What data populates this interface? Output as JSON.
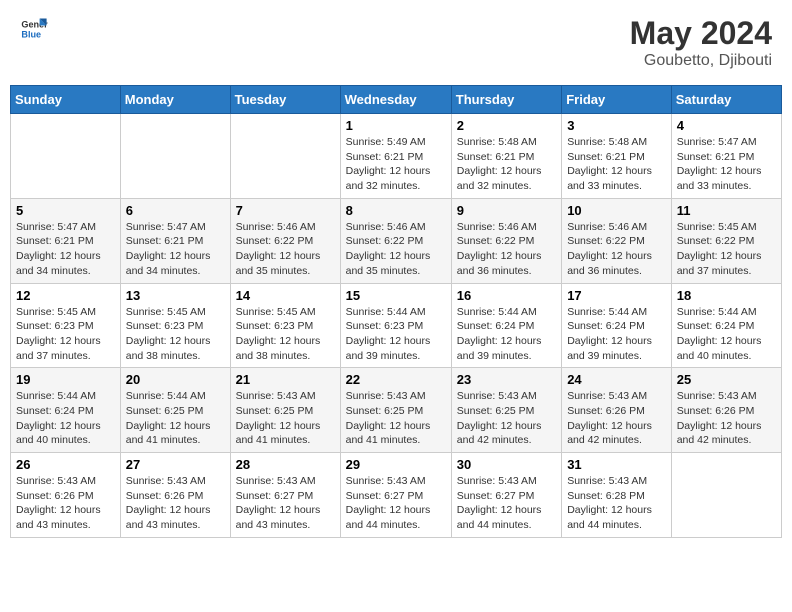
{
  "header": {
    "logo_general": "General",
    "logo_blue": "Blue",
    "month": "May 2024",
    "location": "Goubetto, Djibouti"
  },
  "days_of_week": [
    "Sunday",
    "Monday",
    "Tuesday",
    "Wednesday",
    "Thursday",
    "Friday",
    "Saturday"
  ],
  "weeks": [
    [
      {
        "day": "",
        "sunrise": "",
        "sunset": "",
        "daylight": ""
      },
      {
        "day": "",
        "sunrise": "",
        "sunset": "",
        "daylight": ""
      },
      {
        "day": "",
        "sunrise": "",
        "sunset": "",
        "daylight": ""
      },
      {
        "day": "1",
        "sunrise": "Sunrise: 5:49 AM",
        "sunset": "Sunset: 6:21 PM",
        "daylight": "Daylight: 12 hours and 32 minutes."
      },
      {
        "day": "2",
        "sunrise": "Sunrise: 5:48 AM",
        "sunset": "Sunset: 6:21 PM",
        "daylight": "Daylight: 12 hours and 32 minutes."
      },
      {
        "day": "3",
        "sunrise": "Sunrise: 5:48 AM",
        "sunset": "Sunset: 6:21 PM",
        "daylight": "Daylight: 12 hours and 33 minutes."
      },
      {
        "day": "4",
        "sunrise": "Sunrise: 5:47 AM",
        "sunset": "Sunset: 6:21 PM",
        "daylight": "Daylight: 12 hours and 33 minutes."
      }
    ],
    [
      {
        "day": "5",
        "sunrise": "Sunrise: 5:47 AM",
        "sunset": "Sunset: 6:21 PM",
        "daylight": "Daylight: 12 hours and 34 minutes."
      },
      {
        "day": "6",
        "sunrise": "Sunrise: 5:47 AM",
        "sunset": "Sunset: 6:21 PM",
        "daylight": "Daylight: 12 hours and 34 minutes."
      },
      {
        "day": "7",
        "sunrise": "Sunrise: 5:46 AM",
        "sunset": "Sunset: 6:22 PM",
        "daylight": "Daylight: 12 hours and 35 minutes."
      },
      {
        "day": "8",
        "sunrise": "Sunrise: 5:46 AM",
        "sunset": "Sunset: 6:22 PM",
        "daylight": "Daylight: 12 hours and 35 minutes."
      },
      {
        "day": "9",
        "sunrise": "Sunrise: 5:46 AM",
        "sunset": "Sunset: 6:22 PM",
        "daylight": "Daylight: 12 hours and 36 minutes."
      },
      {
        "day": "10",
        "sunrise": "Sunrise: 5:46 AM",
        "sunset": "Sunset: 6:22 PM",
        "daylight": "Daylight: 12 hours and 36 minutes."
      },
      {
        "day": "11",
        "sunrise": "Sunrise: 5:45 AM",
        "sunset": "Sunset: 6:22 PM",
        "daylight": "Daylight: 12 hours and 37 minutes."
      }
    ],
    [
      {
        "day": "12",
        "sunrise": "Sunrise: 5:45 AM",
        "sunset": "Sunset: 6:23 PM",
        "daylight": "Daylight: 12 hours and 37 minutes."
      },
      {
        "day": "13",
        "sunrise": "Sunrise: 5:45 AM",
        "sunset": "Sunset: 6:23 PM",
        "daylight": "Daylight: 12 hours and 38 minutes."
      },
      {
        "day": "14",
        "sunrise": "Sunrise: 5:45 AM",
        "sunset": "Sunset: 6:23 PM",
        "daylight": "Daylight: 12 hours and 38 minutes."
      },
      {
        "day": "15",
        "sunrise": "Sunrise: 5:44 AM",
        "sunset": "Sunset: 6:23 PM",
        "daylight": "Daylight: 12 hours and 39 minutes."
      },
      {
        "day": "16",
        "sunrise": "Sunrise: 5:44 AM",
        "sunset": "Sunset: 6:24 PM",
        "daylight": "Daylight: 12 hours and 39 minutes."
      },
      {
        "day": "17",
        "sunrise": "Sunrise: 5:44 AM",
        "sunset": "Sunset: 6:24 PM",
        "daylight": "Daylight: 12 hours and 39 minutes."
      },
      {
        "day": "18",
        "sunrise": "Sunrise: 5:44 AM",
        "sunset": "Sunset: 6:24 PM",
        "daylight": "Daylight: 12 hours and 40 minutes."
      }
    ],
    [
      {
        "day": "19",
        "sunrise": "Sunrise: 5:44 AM",
        "sunset": "Sunset: 6:24 PM",
        "daylight": "Daylight: 12 hours and 40 minutes."
      },
      {
        "day": "20",
        "sunrise": "Sunrise: 5:44 AM",
        "sunset": "Sunset: 6:25 PM",
        "daylight": "Daylight: 12 hours and 41 minutes."
      },
      {
        "day": "21",
        "sunrise": "Sunrise: 5:43 AM",
        "sunset": "Sunset: 6:25 PM",
        "daylight": "Daylight: 12 hours and 41 minutes."
      },
      {
        "day": "22",
        "sunrise": "Sunrise: 5:43 AM",
        "sunset": "Sunset: 6:25 PM",
        "daylight": "Daylight: 12 hours and 41 minutes."
      },
      {
        "day": "23",
        "sunrise": "Sunrise: 5:43 AM",
        "sunset": "Sunset: 6:25 PM",
        "daylight": "Daylight: 12 hours and 42 minutes."
      },
      {
        "day": "24",
        "sunrise": "Sunrise: 5:43 AM",
        "sunset": "Sunset: 6:26 PM",
        "daylight": "Daylight: 12 hours and 42 minutes."
      },
      {
        "day": "25",
        "sunrise": "Sunrise: 5:43 AM",
        "sunset": "Sunset: 6:26 PM",
        "daylight": "Daylight: 12 hours and 42 minutes."
      }
    ],
    [
      {
        "day": "26",
        "sunrise": "Sunrise: 5:43 AM",
        "sunset": "Sunset: 6:26 PM",
        "daylight": "Daylight: 12 hours and 43 minutes."
      },
      {
        "day": "27",
        "sunrise": "Sunrise: 5:43 AM",
        "sunset": "Sunset: 6:26 PM",
        "daylight": "Daylight: 12 hours and 43 minutes."
      },
      {
        "day": "28",
        "sunrise": "Sunrise: 5:43 AM",
        "sunset": "Sunset: 6:27 PM",
        "daylight": "Daylight: 12 hours and 43 minutes."
      },
      {
        "day": "29",
        "sunrise": "Sunrise: 5:43 AM",
        "sunset": "Sunset: 6:27 PM",
        "daylight": "Daylight: 12 hours and 44 minutes."
      },
      {
        "day": "30",
        "sunrise": "Sunrise: 5:43 AM",
        "sunset": "Sunset: 6:27 PM",
        "daylight": "Daylight: 12 hours and 44 minutes."
      },
      {
        "day": "31",
        "sunrise": "Sunrise: 5:43 AM",
        "sunset": "Sunset: 6:28 PM",
        "daylight": "Daylight: 12 hours and 44 minutes."
      },
      {
        "day": "",
        "sunrise": "",
        "sunset": "",
        "daylight": ""
      }
    ]
  ]
}
